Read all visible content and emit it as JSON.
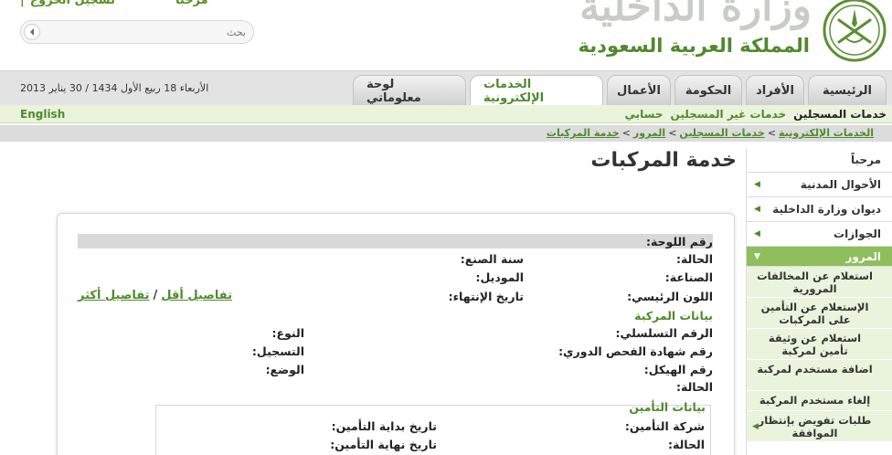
{
  "header": {
    "logo_title": "وزارة الداخلية",
    "logo_subtitle": "المملكة العربية السعودية",
    "welcome": "مرحبا",
    "logout": "تسجيل الخروج",
    "search_placeholder": "بحث"
  },
  "nav": {
    "date": "الأربعاء 18 ربيع الأول 1434 / 30 يناير 2013",
    "tabs": [
      "الرئيسية",
      "الأفراد",
      "الحكومة",
      "الأعمال",
      "الخدمات الإلكترونية",
      "لوحة معلوماتي"
    ],
    "active_tab": "الخدمات الإلكترونية"
  },
  "subnav": {
    "english": "English",
    "registered": "خدمات المسجلين",
    "unregistered": "خدمات غير المسجلين",
    "account": "حسابي"
  },
  "breadcrumb": [
    "الخدمات الإلكترونية",
    "خدمات المسجلين",
    "المرور",
    "خدمة المركبات"
  ],
  "sidebar": {
    "welcome": "مرحباً",
    "items": [
      "الأحوال المدنية",
      "ديوان وزارة الداخلية",
      "الجوازات",
      "المرور"
    ],
    "active": "المرور",
    "sub_items": [
      "استعلام عن المخالفات المرورية",
      "الإستعلام عن التأمين على المركبات",
      "استعلام عن وثيقة تأمين لمركبة",
      "اضافة مستخدم لمركبة",
      "إلغاء مستخدم المركبة",
      "طلبات تفويض بإنتظار الموافقة"
    ]
  },
  "main": {
    "title": "خدمة المركبات",
    "plate_label": "رقم اللوحة:",
    "status": "الحالة:",
    "year": "سنة الصنع:",
    "make": "الصناعة:",
    "model": "الموديل:",
    "color": "اللون الرئيسي:",
    "expiry": "تاريخ الإنتهاء:",
    "more_details": "تفاصيل أكثر",
    "less_details": "تفاصيل أقل",
    "vehicle_data": "بيانات المركبة",
    "serial": "الرقم التسلسلي:",
    "type": "النوع:",
    "inspection": "رقم شهادة الفحص الدوري:",
    "registration": "التسجيل:",
    "chassis": "رقم الهيكل:",
    "state": "الوضع:",
    "status2": "الحالة:",
    "insurance_data": "بيانات التأمين",
    "insurance_company": "شركة التأمين:",
    "insurance_start": "تاريخ بداية التأمين:",
    "insurance_status": "الحالة:",
    "insurance_end": "تاريخ نهاية التأمين:"
  }
}
